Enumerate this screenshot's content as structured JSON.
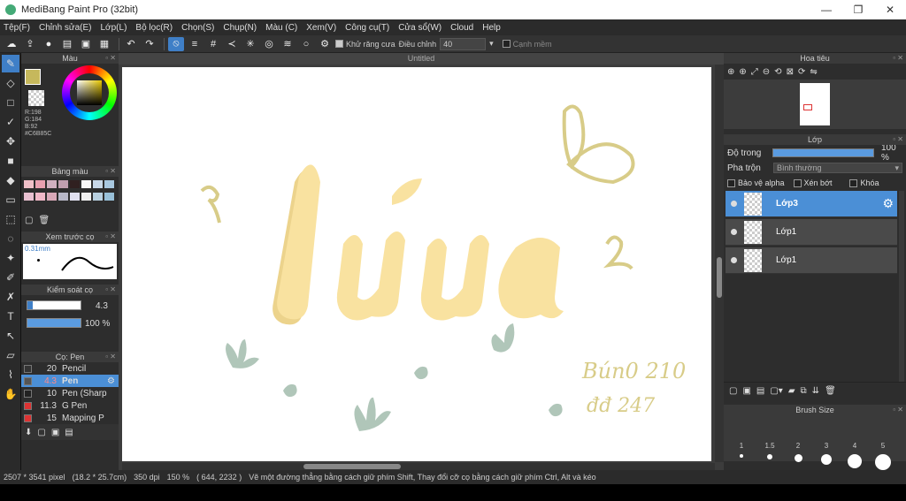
{
  "app": {
    "title": "MediBang Paint Pro (32bit)",
    "minimize": "—",
    "restore": "❐",
    "close": "✕"
  },
  "menu": [
    "Tệp(F)",
    "Chỉnh sửa(E)",
    "Lớp(L)",
    "Bộ lọc(R)",
    "Chọn(S)",
    "Chụp(N)",
    "Màu (C)",
    "Xem(V)",
    "Công cụ(T)",
    "Cửa sổ(W)",
    "Cloud",
    "Help"
  ],
  "toolbar": {
    "antialias_label": "Khử răng cưa",
    "correction_label": "Điều chỉnh",
    "correction_value": "40",
    "edge_label": "Cạnh mềm"
  },
  "document": {
    "tab": "Untitled"
  },
  "color_panel": {
    "title": "Màu",
    "r": "R:198",
    "g": "G:184",
    "b": "B:92",
    "hex": "#C6B85C",
    "fg": "#c6b85c"
  },
  "palette_panel": {
    "title": "Bảng màu",
    "colors": [
      "#f0c0c8",
      "#e8a0b0",
      "#d0b0c0",
      "#c0a0b0",
      "#302020",
      "#f8f8f8",
      "#c8d8e8",
      "#a8c8e0",
      "#e8c0d0",
      "#f0b8c8",
      "#d8a8b8",
      "#b8b8c8",
      "#e0e0f0",
      "#f0f0f0",
      "#b8d0e0",
      "#98c0d8"
    ]
  },
  "preview_panel": {
    "title": "Xem trước cọ",
    "size": "0.31mm"
  },
  "brush_control": {
    "title": "Kiểm soát cọ",
    "size": "4.3",
    "opacity": "100 %"
  },
  "brush_list": {
    "title": "Cọ: Pen",
    "items": [
      {
        "num": "20",
        "name": "Pencil",
        "color": "#333"
      },
      {
        "num": "4.3",
        "name": "Pen",
        "color": "#555",
        "selected": true
      },
      {
        "num": "10",
        "name": "Pen (Sharp",
        "color": "#222"
      },
      {
        "num": "11.3",
        "name": "G Pen",
        "color": "#d33"
      },
      {
        "num": "15",
        "name": "Mapping P",
        "color": "#d33"
      }
    ]
  },
  "navigator": {
    "title": "Hoa tiêu"
  },
  "layer_panel": {
    "title": "Lớp",
    "opacity_label": "Độ trong",
    "opacity_value": "100 %",
    "opacity_fraction": 1.0,
    "blend_label": "Pha trộn",
    "blend_value": "Bình thường",
    "protect_alpha": "Bảo vệ alpha",
    "clipping": "Xén bớt",
    "lock": "Khóa",
    "layers": [
      {
        "name": "Lớp3",
        "selected": true
      },
      {
        "name": "Lớp1",
        "selected": false
      },
      {
        "name": "Lớp1",
        "selected": false
      }
    ]
  },
  "brush_size": {
    "title": "Brush Size",
    "labels": [
      "1",
      "1.5",
      "2",
      "3",
      "4",
      "5"
    ]
  },
  "status": {
    "size": "2507 * 3541 pixel",
    "physical": "(18.2 * 25.7cm)",
    "dpi": "350 dpi",
    "zoom": "150 %",
    "coords": "( 644, 2232 )",
    "hint": "Vẽ một đường thẳng bằng cách giữ phím Shift, Thay đổi cỡ cọ bằng cách giữ phím Ctrl, Alt và kéo"
  },
  "artwork": {
    "word": "Lúa",
    "signature_line1": "Bún0 210",
    "signature_line2": "đđ 247",
    "fill": "#f9e2a0",
    "shadow": "#ecd38c",
    "accent": "#d8cc88",
    "leaf": "#9db8a8"
  }
}
